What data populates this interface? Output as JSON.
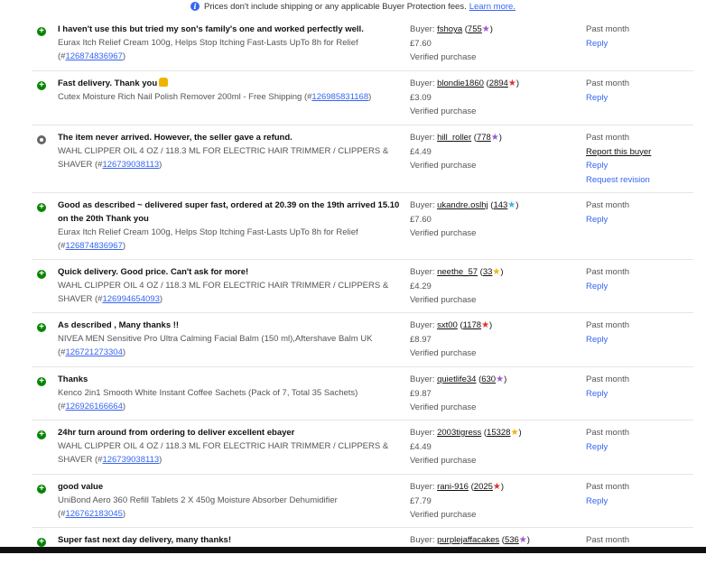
{
  "notice": {
    "text": "Prices don't include shipping or any applicable Buyer Protection fees.",
    "link": "Learn more."
  },
  "colors": {
    "accent": "#3665f3",
    "positive": "#068500",
    "neutral": "#666666"
  },
  "rows": [
    {
      "type": "positive",
      "comment": "I haven't use this but tried my son's family's one and worked perfectly well.",
      "item_text": "Eurax Itch Relief Cream 100g, Helps Stop Itching Fast-Lasts UpTo 8h for Relief (#",
      "item_id": "126874836967",
      "item_suffix": ")",
      "buyer_label": "Buyer:",
      "buyer": "fshoya",
      "score": "755",
      "star_color": "#9b59d0",
      "price": "£7.60",
      "verified": "Verified purchase",
      "when": "Past month",
      "actions": [
        "Reply"
      ]
    },
    {
      "type": "positive",
      "comment": "Fast delivery. Thank you",
      "emoji": true,
      "item_text": "Cutex Moisture Rich Nail Polish Remover 200ml - Free Shipping (#",
      "item_id": "126985831168",
      "item_suffix": ")",
      "buyer_label": "Buyer:",
      "buyer": "blondie1860",
      "score": "2894",
      "star_color": "#e0312f",
      "price": "£3.09",
      "verified": "Verified purchase",
      "when": "Past month",
      "actions": [
        "Reply"
      ]
    },
    {
      "type": "neutral",
      "comment": "The item never arrived. However, the seller gave a refund.",
      "item_text": "WAHL CLIPPER OIL 4 OZ / 118.3 ML FOR ELECTRIC HAIR TRIMMER / CLIPPERS & SHAVER (#",
      "item_id": "126739038113",
      "item_suffix": ")",
      "buyer_label": "Buyer:",
      "buyer": "hill_roller",
      "score": "778",
      "star_color": "#9b59d0",
      "price": "£4.49",
      "verified": "Verified purchase",
      "when": "Past month",
      "report": "Report this buyer",
      "actions": [
        "Reply",
        "Request revision"
      ]
    },
    {
      "type": "positive",
      "comment": "Good as described ~ delivered super fast, ordered at 20.39 on the 19th arrived 15.10 on the 20th Thank you",
      "item_text": "Eurax Itch Relief Cream 100g, Helps Stop Itching Fast-Lasts UpTo 8h for Relief (#",
      "item_id": "126874836967",
      "item_suffix": ")",
      "buyer_label": "Buyer:",
      "buyer": "ukandre.oslhj",
      "score": "143",
      "star_color": "#3bb0e6",
      "price": "£7.60",
      "verified": "Verified purchase",
      "when": "Past month",
      "actions": [
        "Reply"
      ]
    },
    {
      "type": "positive",
      "comment": "Quick delivery. Good price. Can't ask for more!",
      "item_text": "WAHL CLIPPER OIL 4 OZ / 118.3 ML FOR ELECTRIC HAIR TRIMMER / CLIPPERS & SHAVER (#",
      "item_id": "126994654093",
      "item_suffix": ")",
      "buyer_label": "Buyer:",
      "buyer": "neethe_57",
      "score": "33",
      "star_color": "#f0b400",
      "price": "£4.29",
      "verified": "Verified purchase",
      "when": "Past month",
      "actions": [
        "Reply"
      ]
    },
    {
      "type": "positive",
      "comment": "As described , Many thanks !!",
      "item_text": "NIVEA MEN Sensitive Pro Ultra Calming Facial Balm (150 ml),Aftershave Balm UK (#",
      "item_id": "126721273304",
      "item_suffix": ")",
      "buyer_label": "Buyer:",
      "buyer": "sxt00",
      "score": "1178",
      "star_color": "#e0312f",
      "price": "£8.97",
      "verified": "Verified purchase",
      "when": "Past month",
      "actions": [
        "Reply"
      ]
    },
    {
      "type": "positive",
      "comment": "Thanks",
      "item_text": "Kenco 2in1 Smooth White Instant Coffee Sachets (Pack of 7, Total 35 Sachets) (#",
      "item_id": "126926166664",
      "item_suffix": ")",
      "buyer_label": "Buyer:",
      "buyer": "quietlife34",
      "score": "630",
      "star_color": "#9b59d0",
      "price": "£9.87",
      "verified": "Verified purchase",
      "when": "Past month",
      "actions": [
        "Reply"
      ]
    },
    {
      "type": "positive",
      "comment": "24hr turn around from ordering to deliver excellent ebayer",
      "item_text": "WAHL CLIPPER OIL 4 OZ / 118.3 ML FOR ELECTRIC HAIR TRIMMER / CLIPPERS & SHAVER (#",
      "item_id": "126739038113",
      "item_suffix": ")",
      "buyer_label": "Buyer:",
      "buyer": "2003tigress",
      "score": "15328",
      "star_color": "#f0b400",
      "price": "£4.49",
      "verified": "Verified purchase",
      "when": "Past month",
      "actions": [
        "Reply"
      ]
    },
    {
      "type": "positive",
      "comment": "good value",
      "item_text": "UniBond Aero 360 Refill Tablets 2 X 450g Moisture Absorber Dehumidifier (#",
      "item_id": "126762183045",
      "item_suffix": ")",
      "buyer_label": "Buyer:",
      "buyer": "rani-916",
      "score": "2025",
      "star_color": "#e0312f",
      "price": "£7.79",
      "verified": "Verified purchase",
      "when": "Past month",
      "actions": [
        "Reply"
      ]
    },
    {
      "type": "positive",
      "comment": "Super fast next day delivery, many thanks!",
      "item_text": "",
      "item_id": "",
      "item_suffix": "",
      "buyer_label": "Buyer:",
      "buyer": "purplejaffacakes",
      "score": "536",
      "star_color": "#9b59d0",
      "price": "",
      "verified": "",
      "when": "Past month",
      "actions": []
    }
  ]
}
